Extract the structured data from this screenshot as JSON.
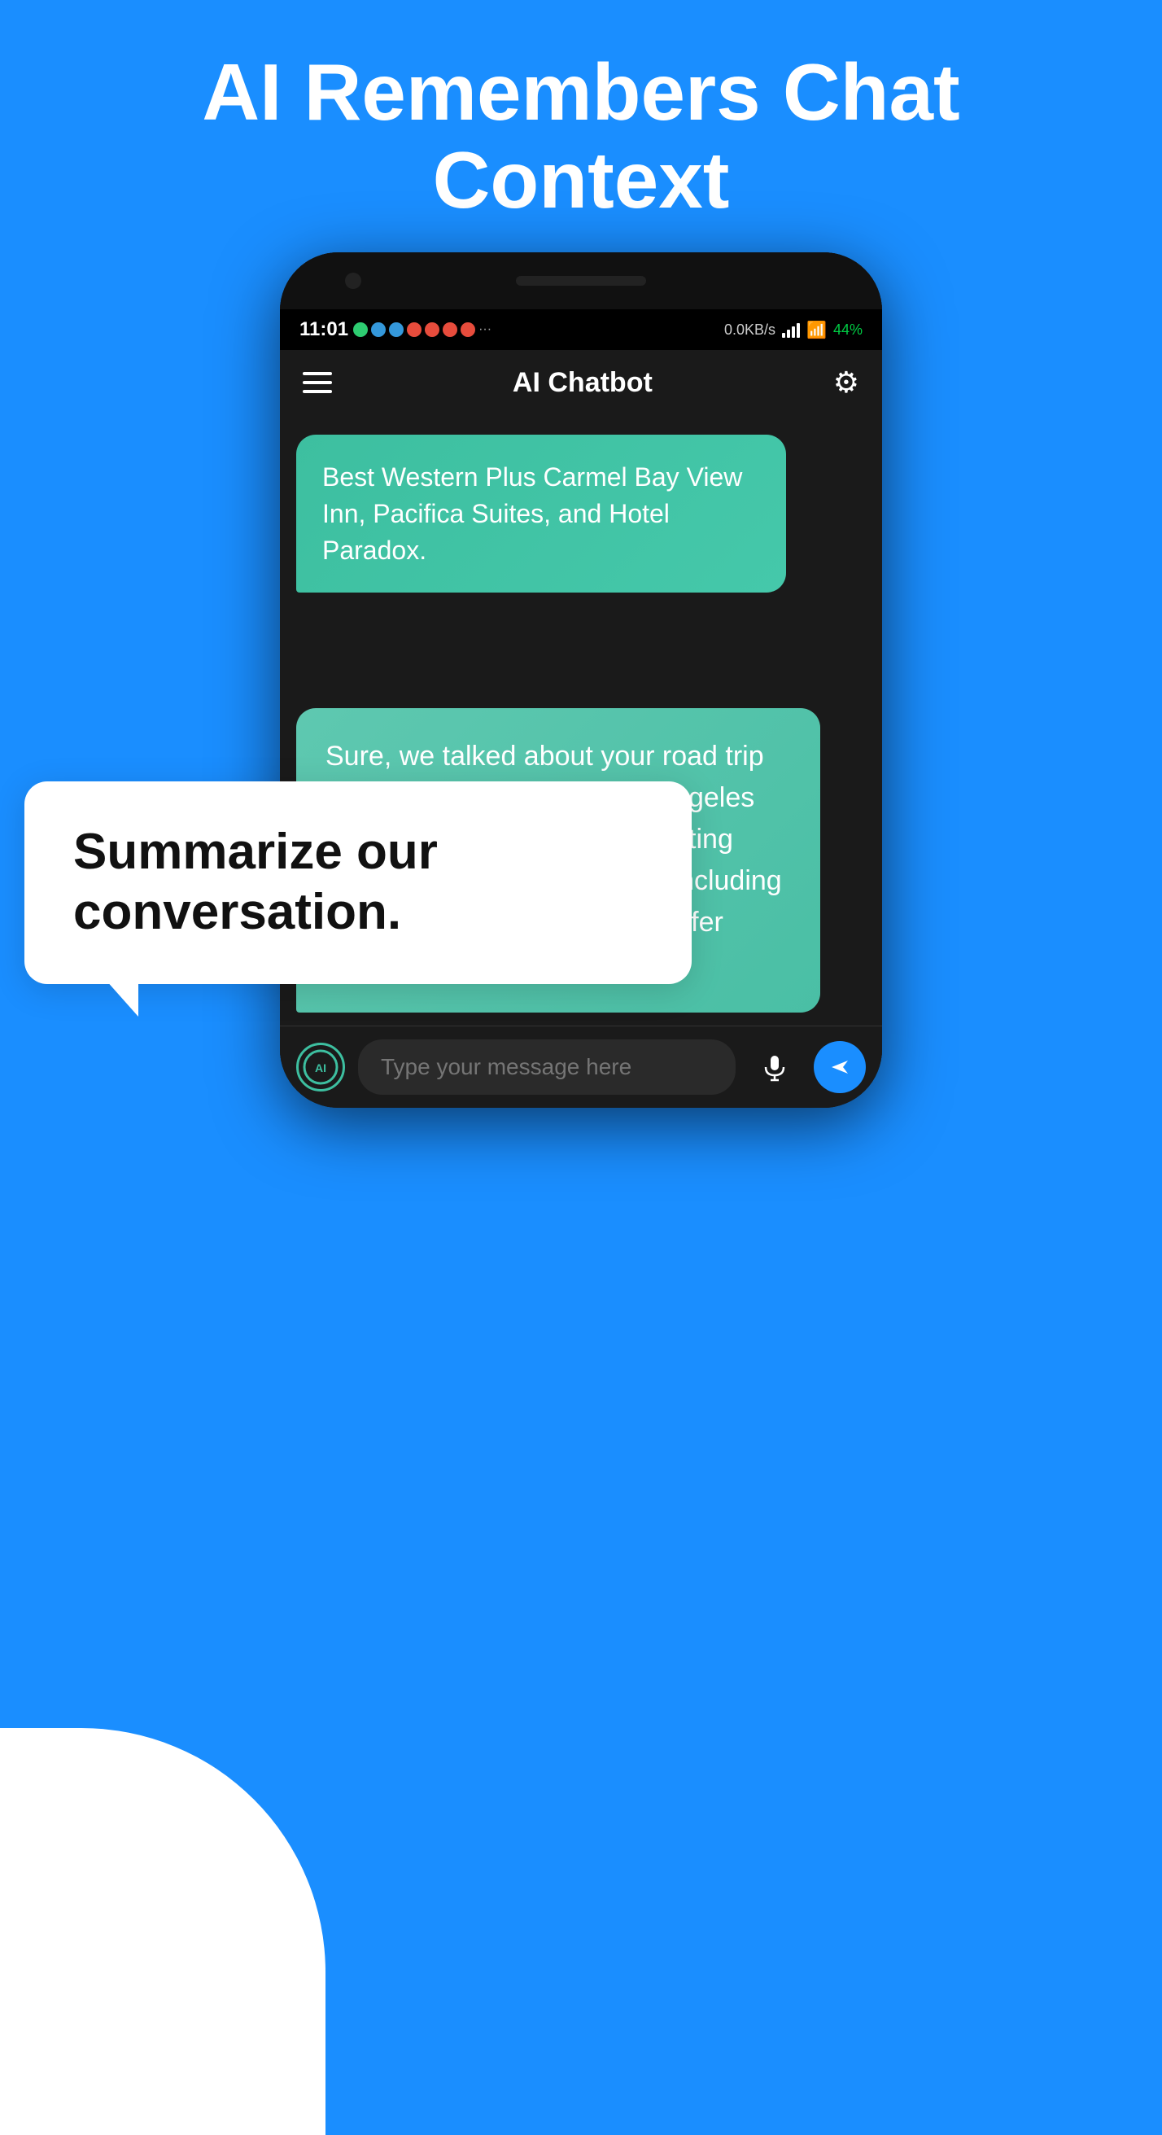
{
  "page": {
    "background_color": "#1a8eff"
  },
  "header": {
    "title": "AI Remembers Chat Context"
  },
  "phone": {
    "status_bar": {
      "time": "11:01",
      "data_speed": "0.0KB/s",
      "battery": "44%"
    },
    "app_bar": {
      "title": "AI Chatbot"
    },
    "messages": [
      {
        "id": "msg1",
        "sender": "ai",
        "text": "Best Western Plus Carmel Bay View Inn, Pacifica Suites, and Hotel Paradox."
      },
      {
        "id": "msg2",
        "sender": "ai_summary",
        "text": "Sure, we talked about your road trip from San Francisco to Los Angeles and I suggested some interesting sights to see along the way, including Monterey Bay Aquarium, Pfeiffer Beach..."
      }
    ],
    "input": {
      "placeholder": "Type your message here"
    }
  },
  "speech_bubble": {
    "text": "Summarize our conversation."
  },
  "icons": {
    "hamburger": "☰",
    "gear": "⚙",
    "mic": "🎤",
    "send": "➤",
    "ai_label": "AI"
  }
}
